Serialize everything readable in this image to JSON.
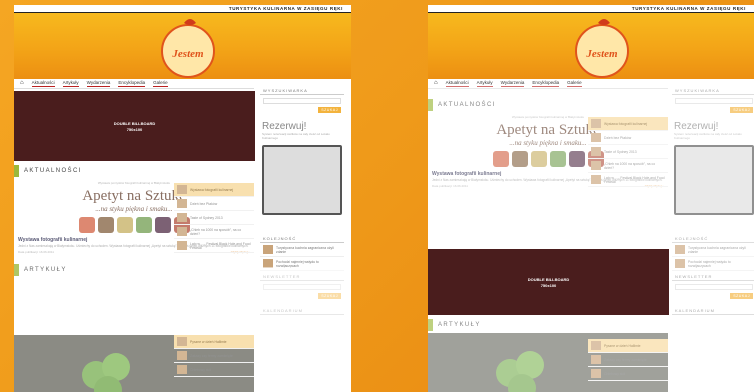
{
  "site": {
    "tagline": "TURYSTYKA KULINARNA W ZASIĘGU RĘKI",
    "logo_text": "Jestem Jem",
    "nav": [
      "Aktualności",
      "Artykuły",
      "Wydarzenia",
      "Encyklopedia",
      "Galerie"
    ]
  },
  "billboard": {
    "line1": "DOUBLE BILLBOARD",
    "line2": "750x100"
  },
  "sections": {
    "news": "AKTUALNOŚCI",
    "articles": "ARTYKUŁY"
  },
  "news": {
    "promo_caption": "Wystawa pomysłów fotografii kulinarnej w Białymstoku",
    "apetyt_big": "Apetyt na Sztukę",
    "apetyt_small": "...na styku piękna i smaku...",
    "title": "Wystawa fotografii kulinarnej",
    "text": "Jedni z Nas zamieszkają w Białymstoku. Uśmiechy do uchoden. Wystawa fotografii kulinarnej „Apetyt na sztukę”. Szczęś pełen ważnych 11 fotografów kulinarnych.",
    "date": "Data publikacji: 16.06.2011",
    "more": "czytaj więcej »"
  },
  "side_items": [
    "Wystawa fotografii kulinarnej",
    "Dzień bez Ptaków",
    "Taste of Sydney 2013",
    "„Chleb na 1000 na sposób”, na co dzień?",
    "Lato w... – Festival Black Hole and Food Festival"
  ],
  "article_items": [
    "Pyszne w dzień Hallimie",
    "Zakazy czy fermy zamknięte",
    "Chlebowy stół"
  ],
  "sidebar": {
    "search_title": "WYSZUKIWARKA",
    "search_placeholder": "Wpisz szukaną frazę",
    "search_button": "SZUKAJ",
    "rez_title": "Rezerwuj!",
    "rez_sub": "System rezerwacji stolików na cały zieść od Lokalu Kulinarnego",
    "box2_title": "KOLEJNOŚĆ",
    "box2_items": [
      "Turystyczna kuchnia zagraniczna ożyli zdanie",
      "Pochodzi najmniej wstydu to rozwijaczycach"
    ],
    "newsletter_title": "NEWSLETTER",
    "newsletter_placeholder": "Adres e-mail",
    "newsletter_button": "SZUKAJ",
    "calendar_title": "KALENDARIUM"
  },
  "colors": {
    "background": "#f29c1f",
    "billboard": "#4a1d1d",
    "accent_green": "#9bb83c"
  }
}
